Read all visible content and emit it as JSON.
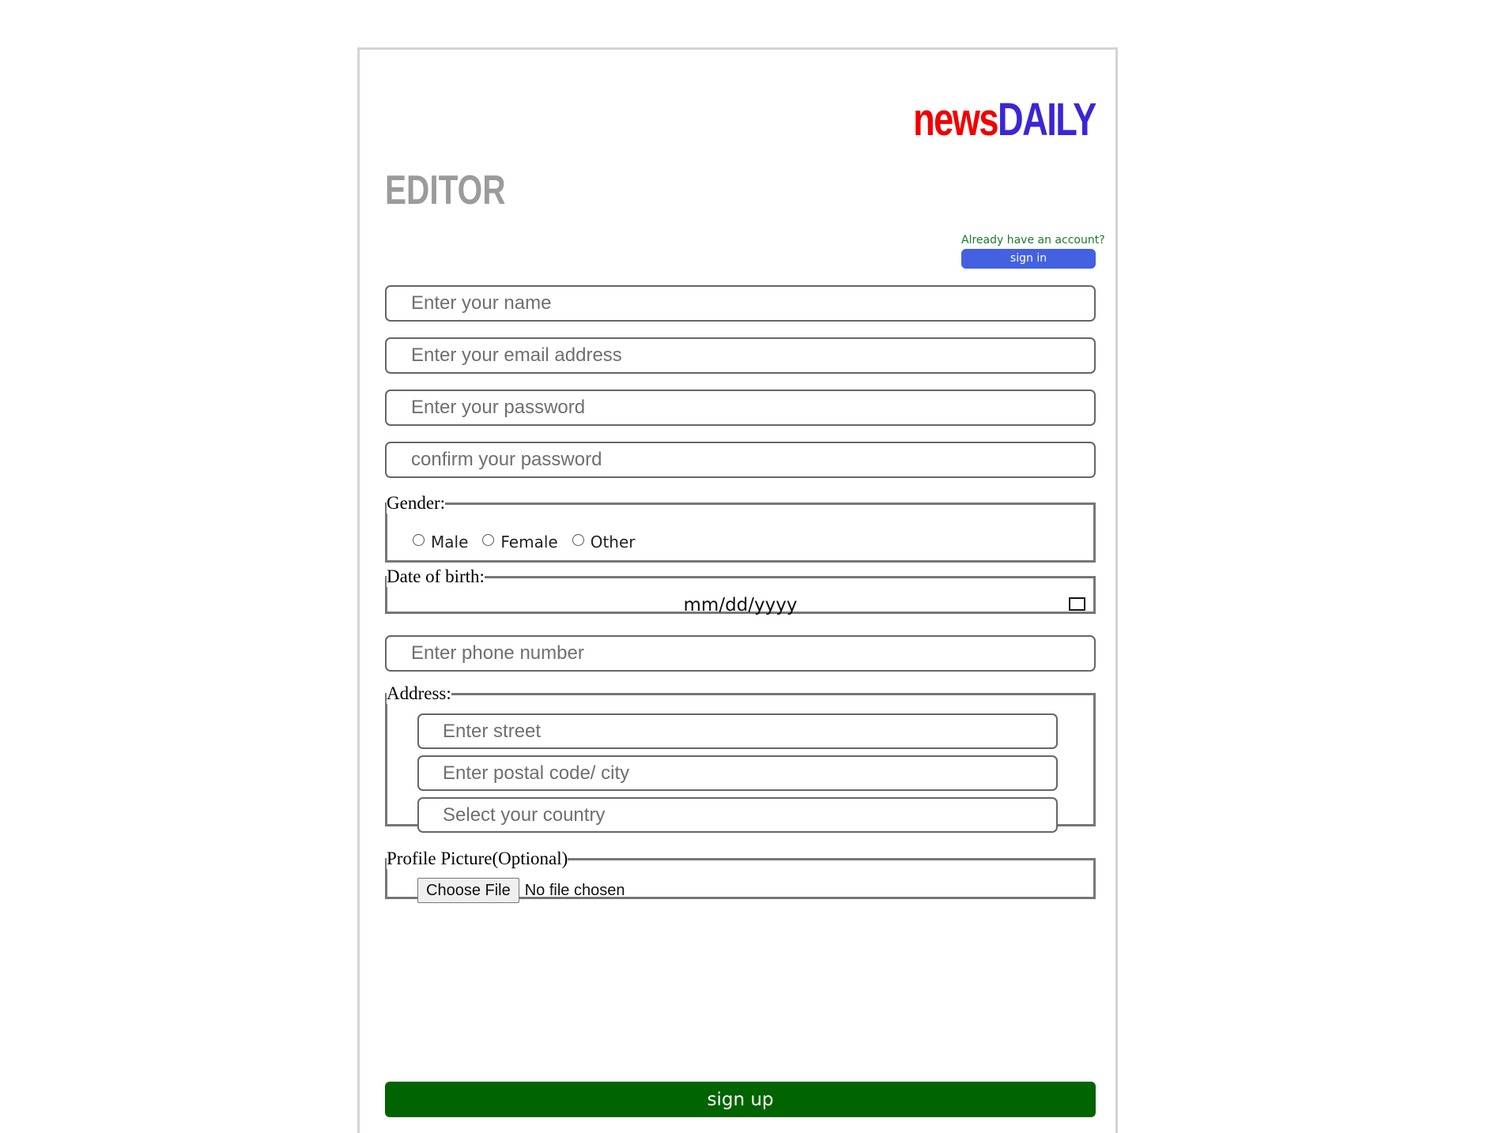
{
  "brand": {
    "name_part1": "news",
    "name_part2": "DAILY",
    "color_part1": "#f20000",
    "color_part2": "#3b26d6"
  },
  "page_title": "EDITOR",
  "signin": {
    "prompt": "Already have an account?",
    "button_label": "sign in"
  },
  "fields": {
    "name_placeholder": "Enter your name",
    "email_placeholder": "Enter your email address",
    "password_placeholder": "Enter your password",
    "confirm_password_placeholder": "confirm your password",
    "phone_placeholder": "Enter phone number"
  },
  "gender": {
    "legend": "Gender:",
    "options": [
      "Male",
      "Female",
      "Other"
    ]
  },
  "dob": {
    "legend": "Date of birth:",
    "value": "mm/dd/yyyy",
    "icon": "calendar-icon"
  },
  "address": {
    "legend": "Address:",
    "street_placeholder": "Enter street",
    "city_placeholder": "Enter postal code/ city",
    "country_placeholder": "Select your country"
  },
  "profile_picture": {
    "legend": "Profile Picture(Optional)",
    "button_label": "Choose File",
    "status": "No file chosen"
  },
  "submit": {
    "label": "sign up",
    "color": "#006400"
  }
}
